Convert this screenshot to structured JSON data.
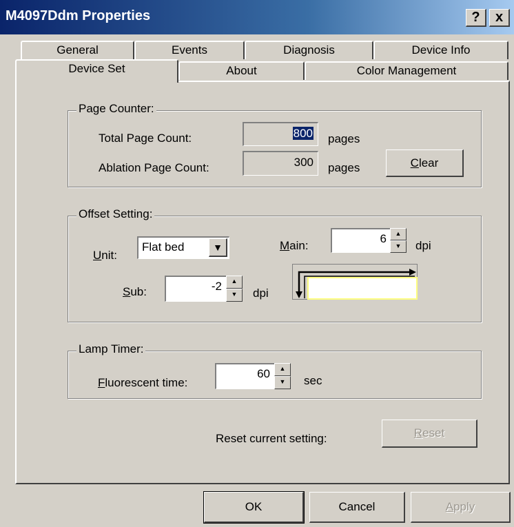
{
  "window": {
    "title": "M4097Ddm Properties",
    "help_label": "?",
    "close_label": "x"
  },
  "tabs": {
    "row_back": [
      {
        "label": "General"
      },
      {
        "label": "Events"
      },
      {
        "label": "Diagnosis"
      },
      {
        "label": "Device Info"
      }
    ],
    "row_front": [
      {
        "label": "Device Set",
        "active": true
      },
      {
        "label": "About"
      },
      {
        "label": "Color Management"
      }
    ]
  },
  "page_counter": {
    "title": "Page Counter:",
    "total_label": "Total Page Count:",
    "total_value": "800",
    "total_unit": "pages",
    "ablation_label": "Ablation Page Count:",
    "ablation_value": "300",
    "ablation_unit": "pages",
    "clear_label_mnemonic": "C",
    "clear_label_rest": "lear"
  },
  "offset_setting": {
    "title": "Offset Setting:",
    "unit_label_mnemonic": "U",
    "unit_label_rest": "nit:",
    "unit_value": "Flat bed",
    "main_label_mnemonic": "M",
    "main_label_rest": "ain:",
    "main_value": "6",
    "main_unit": "dpi",
    "sub_label_mnemonic": "S",
    "sub_label_rest": "ub:",
    "sub_value": "-2",
    "sub_unit": "dpi"
  },
  "lamp_timer": {
    "title": "Lamp Timer:",
    "fluor_label_mnemonic": "F",
    "fluor_label_rest": "luorescent time:",
    "fluor_value": "60",
    "fluor_unit": "sec"
  },
  "reset": {
    "label": "Reset current setting:",
    "button_mnemonic": "R",
    "button_rest": "eset"
  },
  "footer": {
    "ok_label": "OK",
    "cancel_label": "Cancel",
    "apply_mnemonic": "A",
    "apply_rest": "pply"
  },
  "colors": {
    "titlebar_start": "#0a246a",
    "titlebar_end": "#a6caf0",
    "face": "#d4d0c8",
    "preview_highlight": "#ffff80"
  }
}
